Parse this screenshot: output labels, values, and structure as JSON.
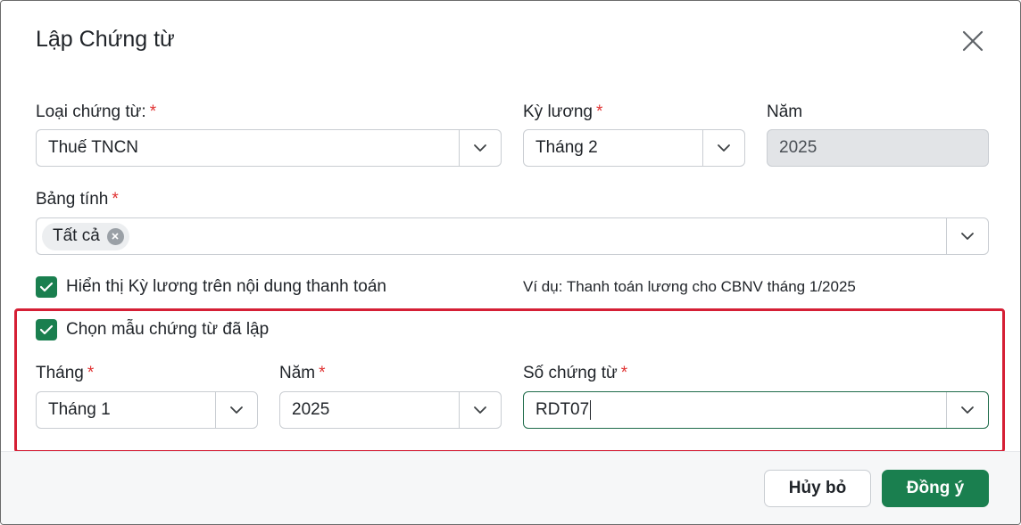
{
  "dialog": {
    "title": "Lập Chứng từ",
    "required_mark": "*"
  },
  "form": {
    "voucher_type": {
      "label": "Loại chứng từ:",
      "value": "Thuế TNCN"
    },
    "pay_period": {
      "label": "Kỳ lương",
      "value": "Tháng 2"
    },
    "year": {
      "label": "Năm",
      "value": "2025"
    },
    "spreadsheet": {
      "label": "Bảng tính",
      "tags": [
        "Tất cả"
      ]
    },
    "show_period": {
      "label": "Hiển thị Kỳ lương trên nội dung thanh toán",
      "checked": true,
      "example": "Ví dụ: Thanh toán lương cho CBNV tháng 1/2025"
    },
    "template": {
      "label": "Chọn mẫu chứng từ đã lập",
      "checked": true,
      "month": {
        "label": "Tháng",
        "value": "Tháng 1"
      },
      "year": {
        "label": "Năm",
        "value": "2025"
      },
      "voucher_no": {
        "label": "Số chứng từ",
        "value": "RDT07"
      }
    }
  },
  "footer": {
    "cancel_label": "Hủy bỏ",
    "ok_label": "Đồng ý"
  },
  "colors": {
    "accent": "#1a7f4f",
    "required": "#e03131",
    "highlight_border": "#d51f35"
  }
}
